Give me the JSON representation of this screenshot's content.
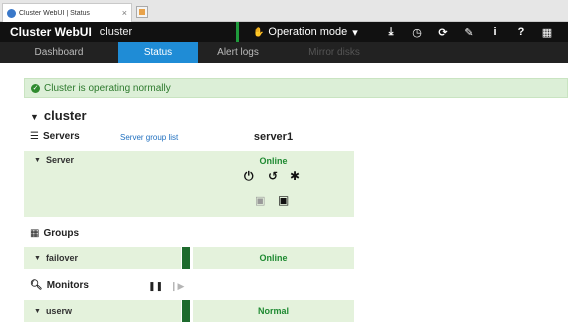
{
  "browser": {
    "tab_title": "Cluster WebUI | Status",
    "tab_close": "×"
  },
  "header": {
    "brand": "Cluster WebUI",
    "cluster_name": "cluster",
    "operation_mode_label": "Operation mode",
    "operation_mode_caret": "▾",
    "tools": [
      "⤓",
      "◷",
      "⟳",
      "✎",
      "i",
      "?",
      "▦"
    ]
  },
  "nav": {
    "tabs": [
      {
        "label": "Dashboard",
        "state": "normal"
      },
      {
        "label": "Status",
        "state": "active"
      },
      {
        "label": "Alert logs",
        "state": "normal"
      },
      {
        "label": "Mirror disks",
        "state": "disabled"
      }
    ]
  },
  "status": {
    "alert_text": "Cluster is operating normally",
    "cluster_title": "cluster",
    "servers_label": "Servers",
    "server_group_link": "Server group list",
    "server_name": "server1",
    "server_row_label": "Server",
    "server_status": "Online",
    "groups_label": "Groups",
    "group_row_label": "failover",
    "group_status": "Online",
    "monitors_label": "Monitors",
    "monitor_row_label": "userw",
    "monitor_status": "Normal"
  },
  "colors": {
    "accent": "#1f8cd6",
    "ok_green": "#1f8a32",
    "panel_green": "#e4f2dc",
    "header_bg": "#111111"
  }
}
